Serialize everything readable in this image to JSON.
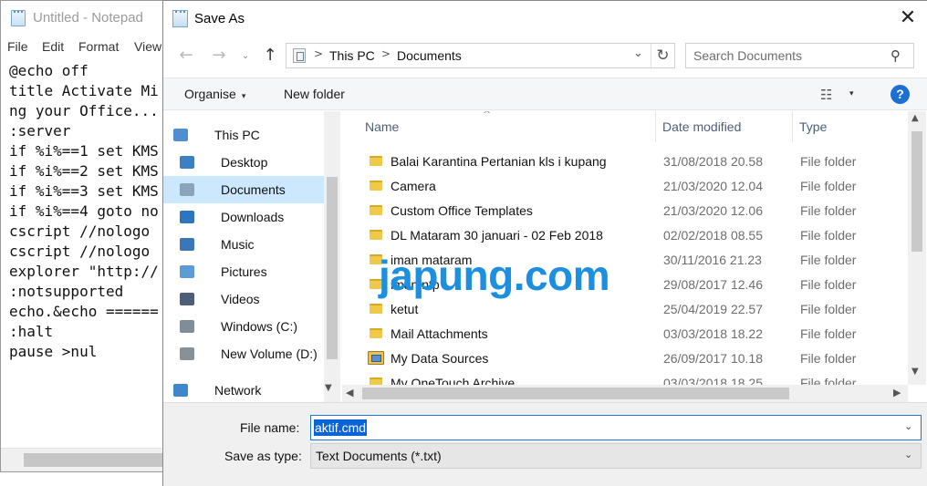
{
  "notepad": {
    "title": "Untitled - Notepad",
    "menu": [
      "File",
      "Edit",
      "Format",
      "View"
    ],
    "lines": [
      "@echo off",
      "title Activate Mi",
      "ng your Office...",
      ":server",
      "if %i%==1 set KMS",
      "if %i%==2 set KMS",
      "if %i%==3 set KMS",
      "if %i%==4 goto no",
      "cscript //nologo",
      "cscript //nologo",
      "explorer \"http://",
      ":notsupported",
      "echo.&echo ======",
      ":halt",
      "pause >nul"
    ]
  },
  "dialog": {
    "title": "Save As",
    "close_glyph": "✕",
    "nav": {
      "back": "←",
      "forward": "→",
      "recent": "⌄",
      "up": "↑"
    },
    "breadcrumb": [
      "This PC",
      "Documents"
    ],
    "breadcrumb_sep": ">",
    "dropdown_glyph": "⌄",
    "refresh_glyph": "↻",
    "search_placeholder": "Search Documents",
    "search_glyph": "⚲",
    "toolbar": {
      "organise": "Organise",
      "caret": "▾",
      "new_folder": "New folder",
      "view_glyph": "☷",
      "help": "?"
    },
    "nav_pane": [
      {
        "label": "This PC",
        "icon": "pc-icon",
        "selected": false
      },
      {
        "label": "Desktop",
        "icon": "desktop-icon",
        "selected": false
      },
      {
        "label": "Documents",
        "icon": "documents-icon",
        "selected": true
      },
      {
        "label": "Downloads",
        "icon": "downloads-icon",
        "selected": false
      },
      {
        "label": "Music",
        "icon": "music-icon",
        "selected": false
      },
      {
        "label": "Pictures",
        "icon": "pictures-icon",
        "selected": false
      },
      {
        "label": "Videos",
        "icon": "videos-icon",
        "selected": false
      },
      {
        "label": "Windows (C:)",
        "icon": "drive-c-icon",
        "selected": false
      },
      {
        "label": "New Volume (D:)",
        "icon": "drive-d-icon",
        "selected": false
      },
      {
        "label": "Network",
        "icon": "network-icon",
        "selected": false
      }
    ],
    "columns": [
      "Name",
      "Date modified",
      "Type"
    ],
    "sort_glyph": "^",
    "files": [
      {
        "name": "Balai Karantina Pertanian kls i kupang",
        "date": "31/08/2018 20.58",
        "type": "File folder",
        "icon": "folder-icon"
      },
      {
        "name": "Camera",
        "date": "21/03/2020 12.04",
        "type": "File folder",
        "icon": "folder-icon"
      },
      {
        "name": "Custom Office Templates",
        "date": "21/03/2020 12.06",
        "type": "File folder",
        "icon": "folder-icon"
      },
      {
        "name": "DL Mataram 30 januari - 02 Feb 2018",
        "date": "02/02/2018 08.55",
        "type": "File folder",
        "icon": "folder-icon"
      },
      {
        "name": "iman mataram",
        "date": "30/11/2016 21.23",
        "type": "File folder",
        "icon": "folder-icon"
      },
      {
        "name": "iman ntp",
        "date": "29/08/2017 12.46",
        "type": "File folder",
        "icon": "folder-icon"
      },
      {
        "name": "ketut",
        "date": "25/04/2019 22.57",
        "type": "File folder",
        "icon": "folder-icon"
      },
      {
        "name": "Mail Attachments",
        "date": "03/03/2018 18.22",
        "type": "File folder",
        "icon": "folder-icon"
      },
      {
        "name": "My Data Sources",
        "date": "26/09/2017 10.18",
        "type": "File folder",
        "icon": "data-sources-icon"
      },
      {
        "name": "My OneTouch Archive",
        "date": "03/03/2018 18.25",
        "type": "File folder",
        "icon": "folder-icon"
      }
    ],
    "scroll_glyphs": {
      "up": "▲",
      "down": "▼",
      "left": "◀",
      "right": "▶"
    },
    "watermark": "japung.com",
    "file_name_label": "File name:",
    "file_name_value": "aktif.cmd",
    "save_type_label": "Save as type:",
    "save_type_value": "Text Documents (*.txt)",
    "colors": {
      "selection": "#cce8ff",
      "accent": "#1e78d7",
      "header_text": "#4c607a",
      "watermark": "#1c8fe0",
      "folder": "#f0c94b"
    }
  }
}
